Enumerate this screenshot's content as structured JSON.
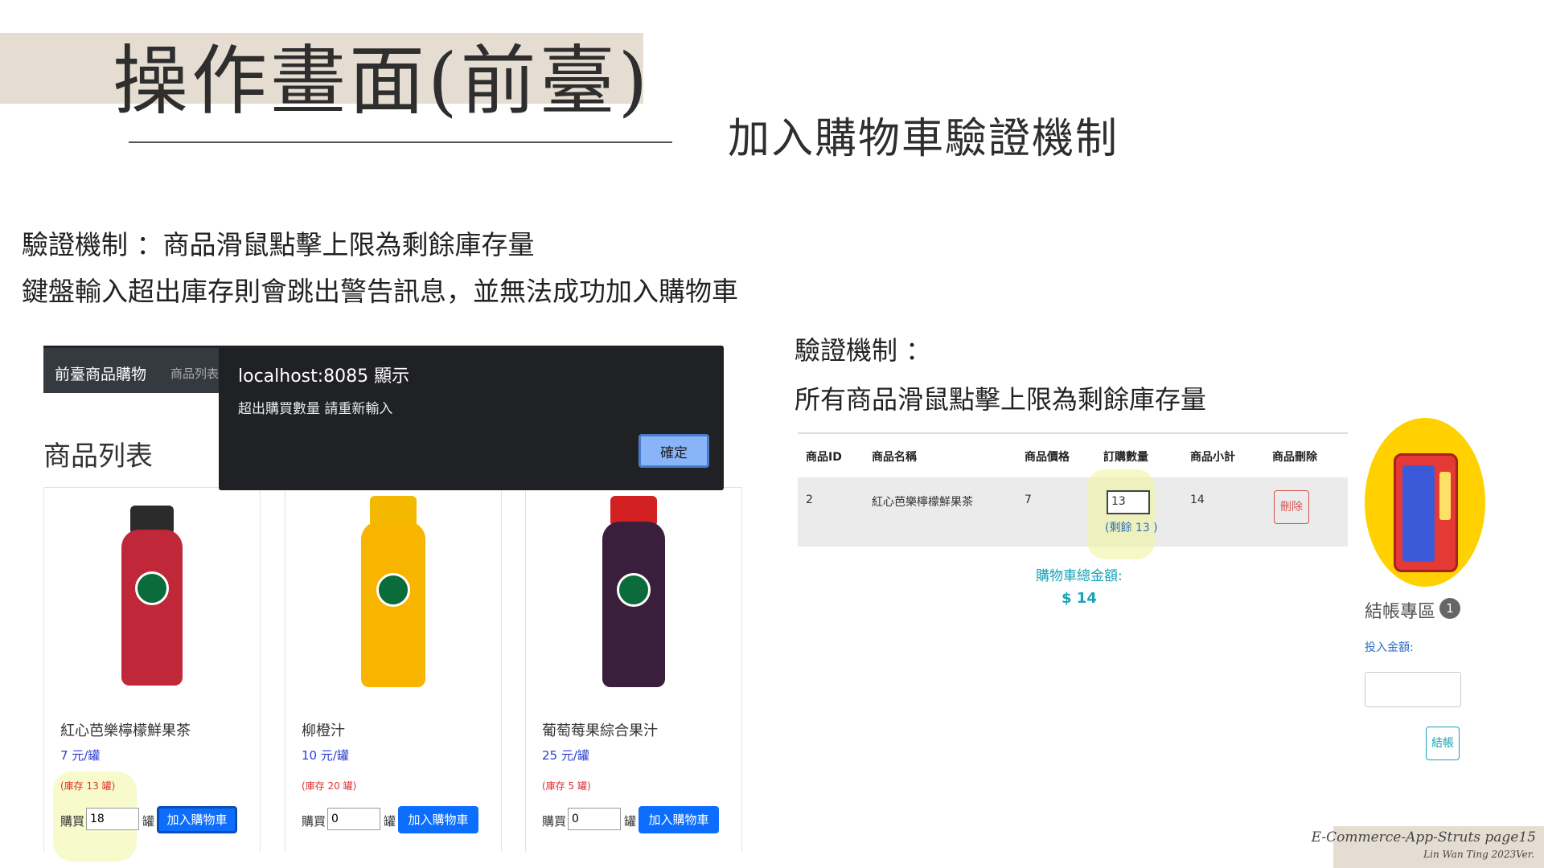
{
  "slide": {
    "title": "操作畫面(前臺)",
    "subtitle": "加入購物車驗證機制",
    "desc_line1": "驗證機制 ：商品滑鼠點擊上限為剩餘庫存量",
    "desc_line2": "鍵盤輸入超出庫存則會跳出警告訊息，並無法成功加入購物車",
    "right_desc_line1": "驗證機制 ：",
    "right_desc_line2": "所有商品滑鼠點擊上限為剩餘庫存量",
    "footer_line1": "E-Commerce-App-Struts page15",
    "footer_line2": "Lin Wan Ting 2023Ver."
  },
  "shop": {
    "nav_brand": "前臺商品購物",
    "nav_link": "商品列表",
    "heading": "商品列表",
    "buy_label": "購買",
    "unit": "罐",
    "add_button": "加入購物車",
    "products": [
      {
        "name": "紅心芭樂檸檬鮮果茶",
        "price": "7 元/罐",
        "stock": "(庫存 13 罐)",
        "qty": "18",
        "color": "#c0283a"
      },
      {
        "name": "柳橙汁",
        "price": "10 元/罐",
        "stock": "(庫存 20 罐)",
        "qty": "0",
        "color": "#f7b500"
      },
      {
        "name": "葡萄莓果綜合果汁",
        "price": "25 元/罐",
        "stock": "(庫存 5 罐)",
        "qty": "0",
        "color": "#3a1f3d"
      }
    ]
  },
  "alert": {
    "origin": "localhost:8085 顯示",
    "message": "超出購買數量 請重新輸入",
    "ok": "確定"
  },
  "cart": {
    "headers": [
      "商品ID",
      "商品名稱",
      "商品價格",
      "訂購數量",
      "商品小計",
      "商品刪除"
    ],
    "row": {
      "id": "2",
      "name": "紅心芭樂檸檬鮮果茶",
      "price": "7",
      "qty": "13",
      "remain": "(剩餘 13 )",
      "subtotal": "14",
      "delete": "刪除"
    },
    "total_label": "購物車總金額:",
    "total_value": "$ 14"
  },
  "checkout": {
    "title": "結帳專區",
    "badge": "1",
    "pay_label": "投入金額:",
    "button": "結帳"
  }
}
